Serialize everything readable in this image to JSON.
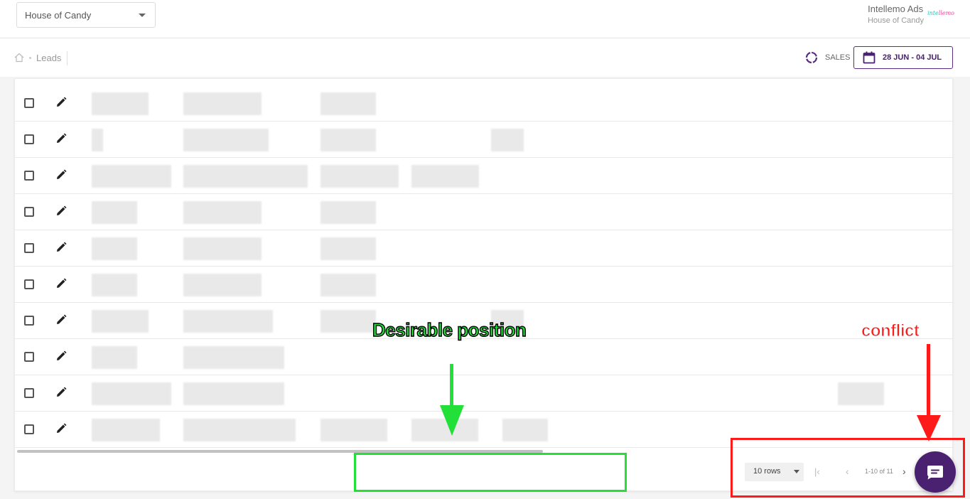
{
  "header": {
    "account_select_value": "House of Candy",
    "user_name": "Intellemo Ads",
    "user_company": "House of Candy",
    "logo_text": "intellemo"
  },
  "breadcrumb": {
    "current": "Leads"
  },
  "toolbar": {
    "sales_label": "SALES",
    "date_range": "28 JUN - 04 JUL"
  },
  "table": {
    "row_count": 10
  },
  "pagination": {
    "rows_per_page": "10 rows",
    "range_text": "1-10 of 11"
  },
  "annotations": {
    "desirable_label": "Desirable position",
    "conflict_label": "conflict",
    "desirable_color": "#22e038",
    "conflict_color": "#ff1a1a"
  },
  "colors": {
    "brand_purple": "#4a2070"
  }
}
